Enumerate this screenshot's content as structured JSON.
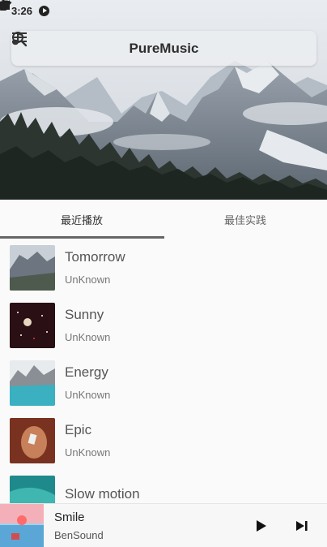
{
  "status_bar": {
    "time": "3:26"
  },
  "app_bar": {
    "title": "PureMusic"
  },
  "tabs": [
    {
      "label": "最近播放",
      "selected": true
    },
    {
      "label": "最佳实践",
      "selected": false
    }
  ],
  "songs": [
    {
      "title": "Tomorrow",
      "artist": "UnKnown"
    },
    {
      "title": "Sunny",
      "artist": "UnKnown"
    },
    {
      "title": "Energy",
      "artist": "UnKnown"
    },
    {
      "title": "Epic",
      "artist": "UnKnown"
    },
    {
      "title": "Slow motion",
      "artist": ""
    }
  ],
  "now_playing": {
    "title": "Smile",
    "artist": "BenSound"
  },
  "colors": {
    "accent_indicator": "#666666",
    "background": "#fafafa"
  }
}
